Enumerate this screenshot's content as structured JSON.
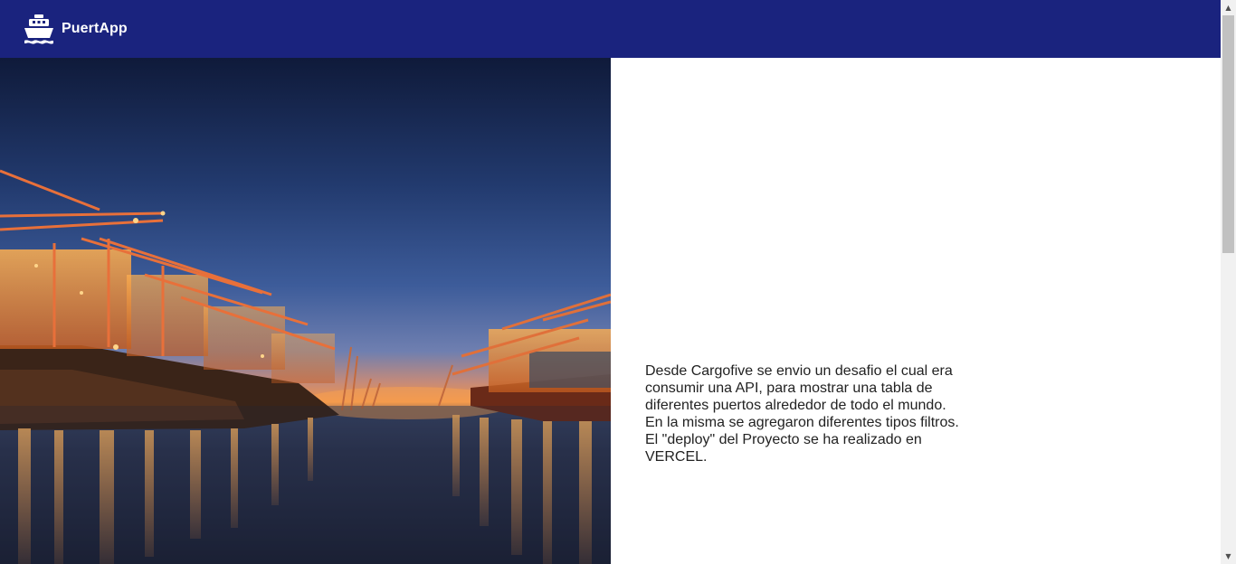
{
  "header": {
    "app_name": "PuertApp",
    "logo_icon": "ship-icon",
    "background_color": "#1a237e"
  },
  "hero": {
    "image_icon": "container-port-at-dusk-photo"
  },
  "main": {
    "description": "Desde Cargofive se envio un desafio el cual era\nconsumir una API, para mostrar una tabla de\ndiferentes puertos alrededor de todo el mundo.\nEn la misma se agregaron diferentes tipos filtros.\nEl \"deploy\" del Proyecto se ha realizado en\nVERCEL."
  },
  "scrollbar": {
    "up_icon": "scroll-up-arrow-icon",
    "down_icon": "scroll-down-arrow-icon"
  }
}
